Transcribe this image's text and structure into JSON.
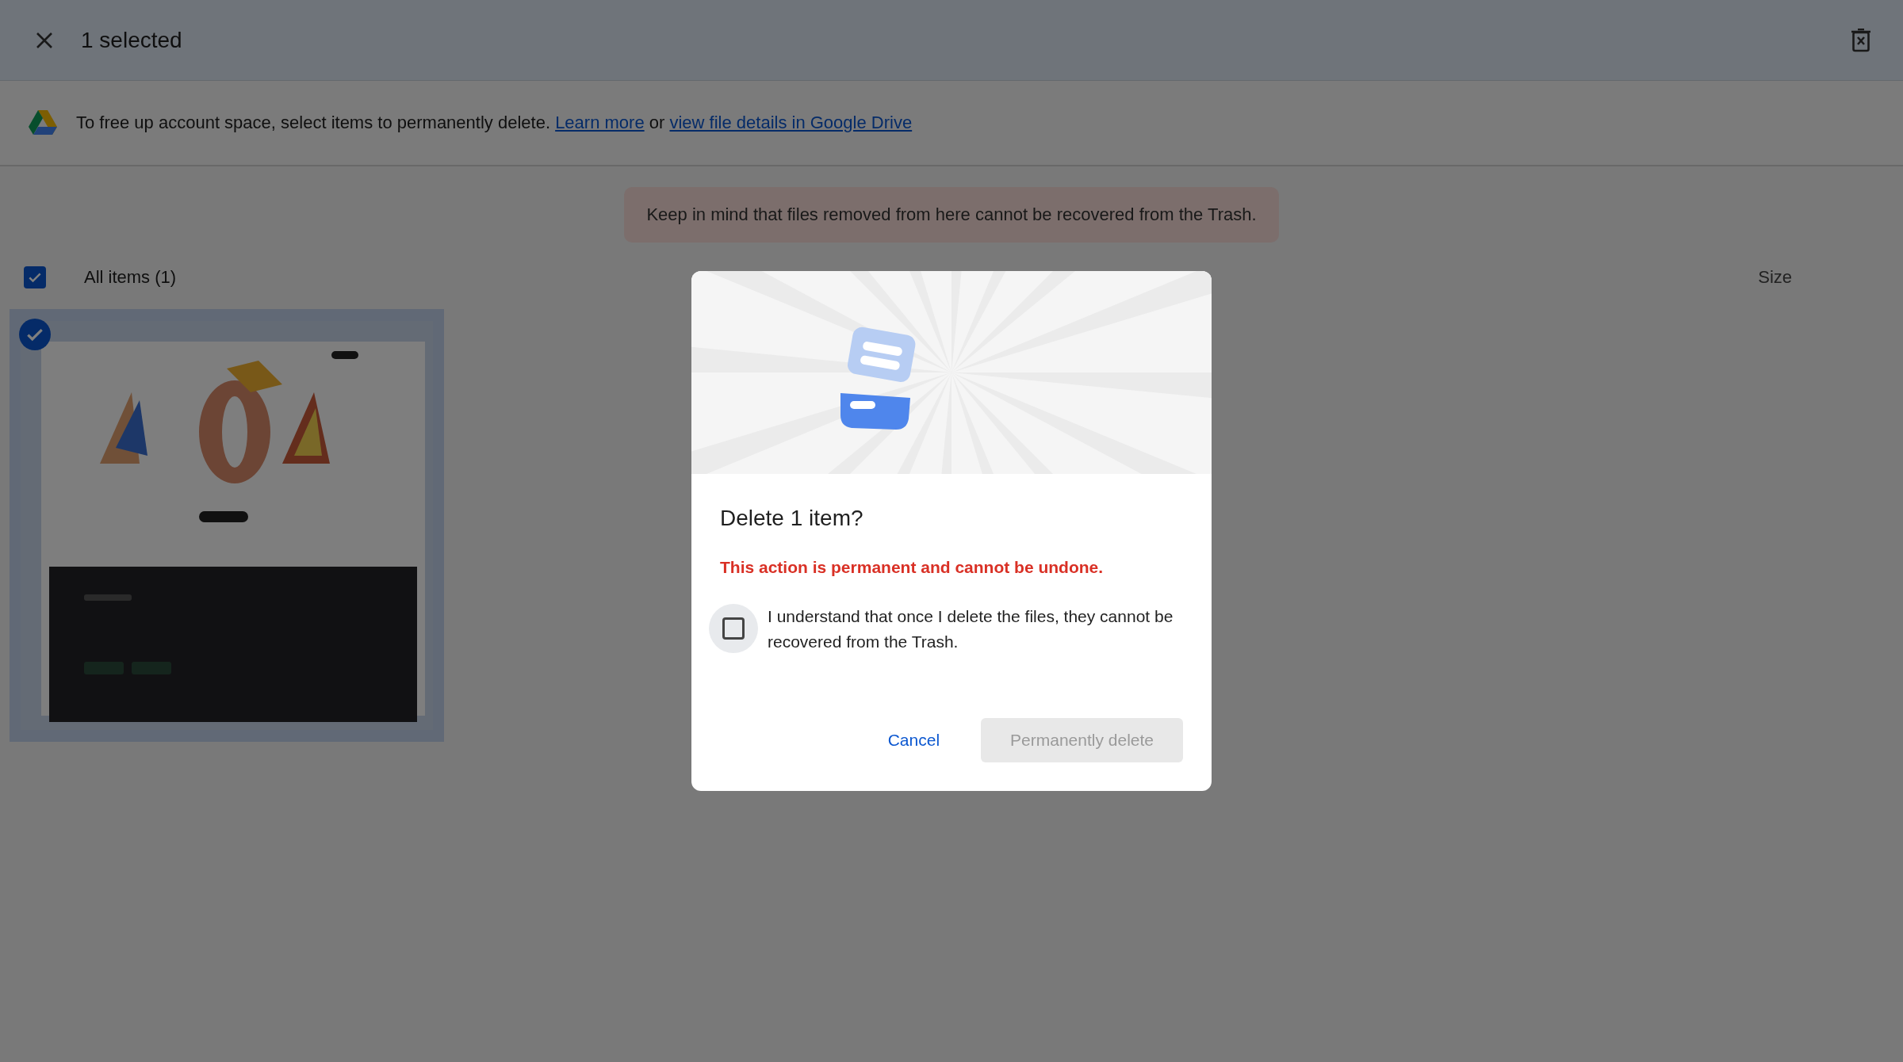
{
  "top_bar": {
    "title": "1 selected"
  },
  "info_banner": {
    "segments": [
      {
        "kind": "text",
        "text": "To free up account space, select items to permanently delete."
      },
      {
        "kind": "link",
        "text": "Learn more"
      },
      {
        "kind": "text",
        "text": "or"
      },
      {
        "kind": "link",
        "text": "view file details in Google Drive"
      }
    ]
  },
  "notice": "Keep in mind that files removed from here cannot be recovered from the Trash.",
  "list_header": {
    "label": "All items (1)",
    "checked": true,
    "size_label": "Size"
  },
  "items": [
    {
      "kind": "picture",
      "selected": true
    }
  ],
  "dialog": {
    "title": "Delete 1 item?",
    "warning": "This action is permanent and cannot be undone.",
    "confirm": {
      "label": "I understand that once I delete the files, they cannot be recovered from the Trash.",
      "checked": false
    },
    "buttons": [
      {
        "kind": "text",
        "label": "Cancel",
        "disabled": false
      },
      {
        "kind": "filled",
        "label": "Permanently delete",
        "disabled": true
      }
    ]
  }
}
